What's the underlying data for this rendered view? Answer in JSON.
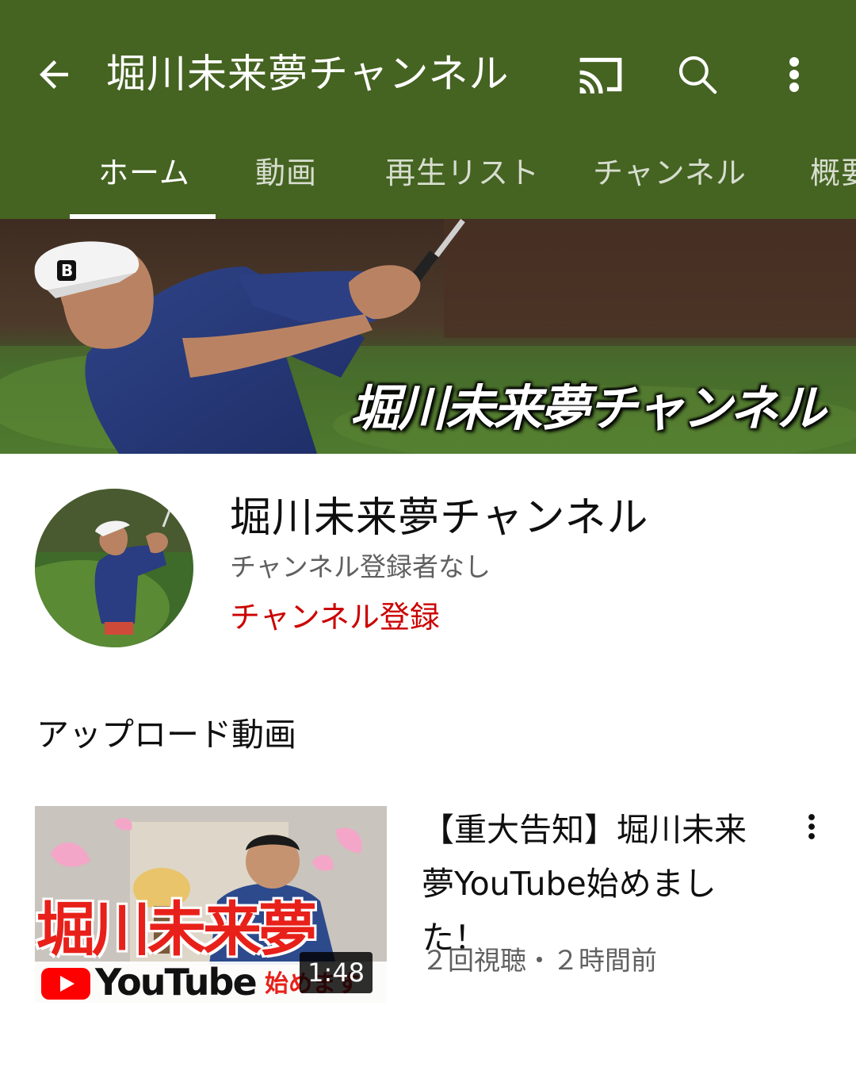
{
  "colors": {
    "appbar": "#456321",
    "subscribe": "#cc0000",
    "muted": "#606060"
  },
  "appbar": {
    "back_icon": "arrow-back-icon",
    "title": "堀川未来夢チャンネル",
    "cast_icon": "cast-icon",
    "search_icon": "search-icon",
    "more_icon": "more-vert-icon"
  },
  "tabs": [
    {
      "label": "ホーム",
      "active": true
    },
    {
      "label": "動画",
      "active": false
    },
    {
      "label": "再生リスト",
      "active": false
    },
    {
      "label": "チャンネル",
      "active": false
    },
    {
      "label": "概要",
      "active": false
    }
  ],
  "banner": {
    "text": "堀川未来夢チャンネル"
  },
  "channel": {
    "name": "堀川未来夢チャンネル",
    "subscribers": "チャンネル登録者なし",
    "subscribe_label": "チャンネル登録"
  },
  "uploads": {
    "section_title": "アップロード動画",
    "videos": [
      {
        "title": "【重大告知】堀川未来夢YouTube始めました！",
        "meta": "２回視聴・２時間前",
        "duration": "1:48",
        "thumbnail_text": {
          "name": "堀川未来夢",
          "yt_word": "YouTube",
          "suffix": "始めます"
        }
      }
    ]
  }
}
